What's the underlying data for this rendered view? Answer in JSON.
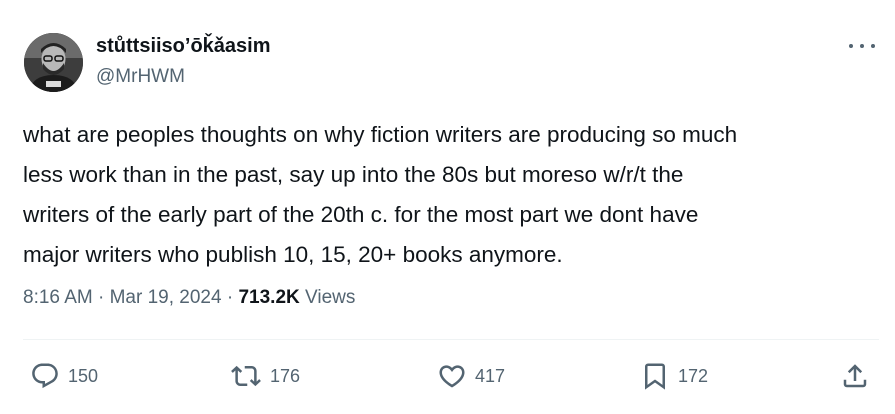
{
  "author": {
    "display_name": "stůttsiiso’ōǩǎasim",
    "handle": "@MrHWM",
    "avatar_icon": "avatar-photo"
  },
  "tweet": {
    "text_lines": [
      "what are peoples thoughts on why fiction writers are producing so much",
      "less work than in the past, say up into the 80s but moreso w/r/t the",
      "writers of the early part of the 20th c. for the most part we dont have",
      "major writers who publish 10, 15, 20+ books anymore."
    ]
  },
  "meta": {
    "time": "8:16 AM",
    "separator": "·",
    "date": "Mar 19, 2024",
    "views_count": "713.2K",
    "views_label": "Views"
  },
  "actions": {
    "replies": "150",
    "retweets": "176",
    "likes": "417",
    "bookmarks": "172"
  },
  "colors": {
    "text": "#0f1419",
    "secondary": "#536471",
    "divider": "#eff3f4"
  }
}
